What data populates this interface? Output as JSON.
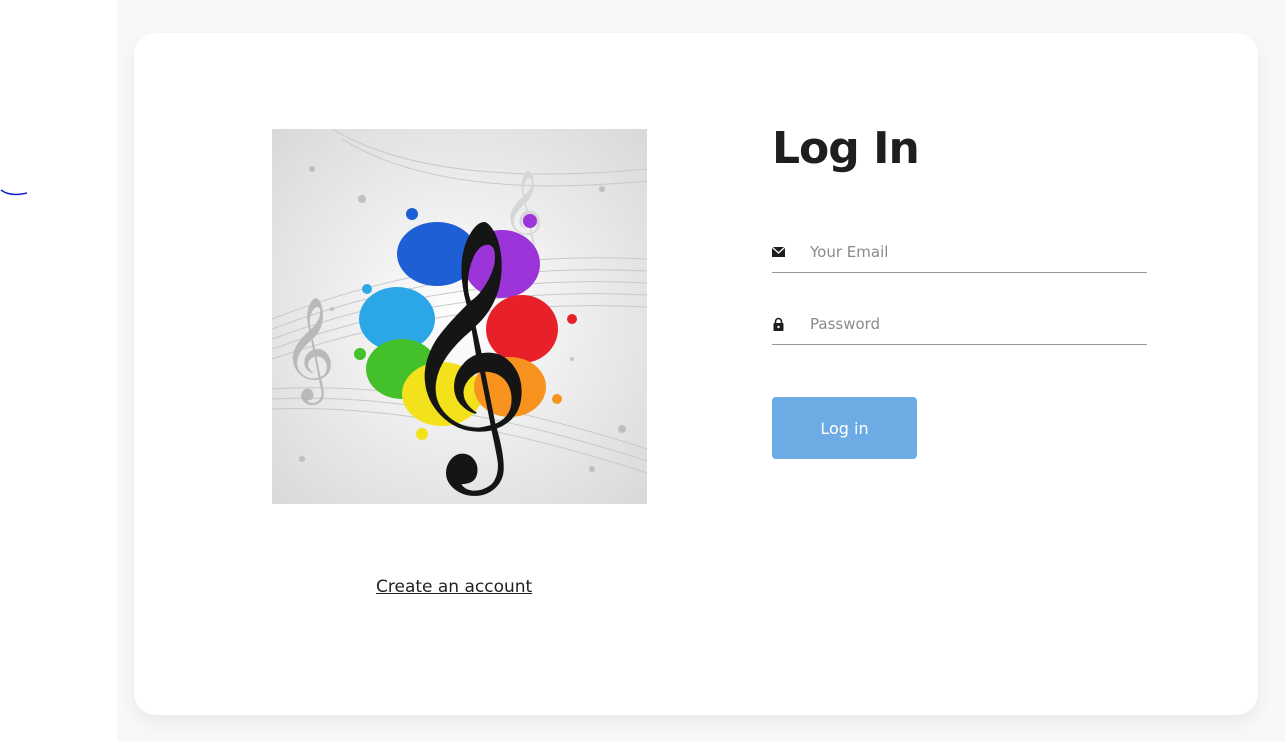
{
  "form": {
    "title": "Log In",
    "email": {
      "placeholder": "Your Email",
      "value": "",
      "icon": "envelope-icon"
    },
    "password": {
      "placeholder": "Password",
      "value": "",
      "icon": "lock-icon"
    },
    "submit_label": "Log in"
  },
  "links": {
    "create_account": "Create an account"
  },
  "colors": {
    "button": "#6dabe4",
    "page_background": "#f8f8f8",
    "card_background": "#ffffff"
  }
}
